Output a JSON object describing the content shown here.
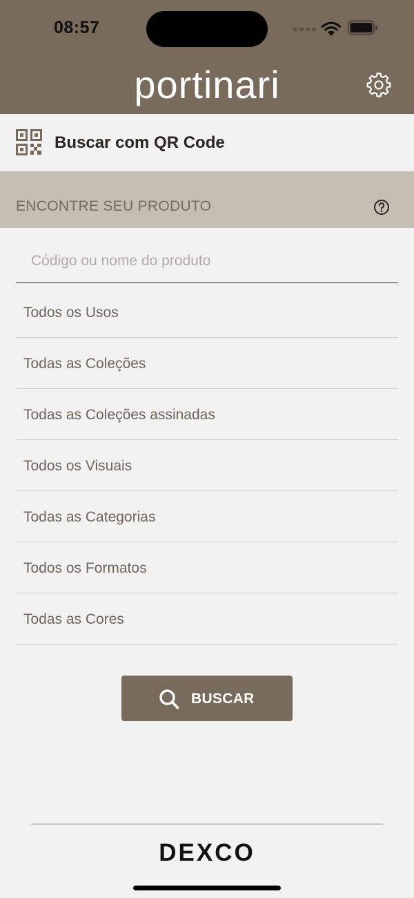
{
  "status_bar": {
    "time": "08:57"
  },
  "header": {
    "logo": "portinari",
    "settings_icon": "gear-icon",
    "background": "#786b5c"
  },
  "qr_search": {
    "icon": "qr-code-icon",
    "label": "Buscar com QR Code"
  },
  "find_product": {
    "title": "ENCONTRE SEU PRODUTO",
    "help_icon": "question-circle-icon"
  },
  "search": {
    "placeholder": "Código ou nome do produto",
    "value": ""
  },
  "filters": [
    {
      "label": "Todos os Usos"
    },
    {
      "label": "Todas as Coleções"
    },
    {
      "label": "Todas as Coleções assinadas"
    },
    {
      "label": "Todos os Visuais"
    },
    {
      "label": "Todas as Categorias"
    },
    {
      "label": "Todos os Formatos"
    },
    {
      "label": "Todas as Cores"
    }
  ],
  "buscar_button": {
    "label": "BUSCAR",
    "icon": "search-icon"
  },
  "footer": {
    "brand": "DEXCO"
  }
}
